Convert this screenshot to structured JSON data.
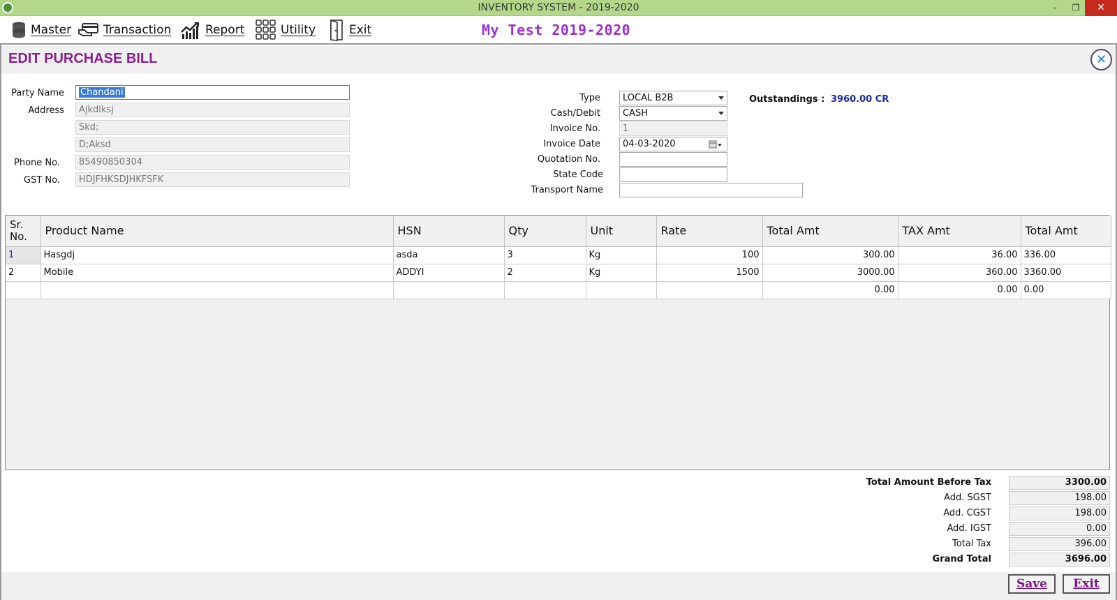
{
  "window": {
    "title": "INVENTORY SYSTEM - 2019-2020",
    "min": "–",
    "max": "❐",
    "close": "✕"
  },
  "menu": {
    "master": "Master",
    "transaction": "Transaction",
    "report": "Report",
    "utility": "Utility",
    "exit": "Exit"
  },
  "company": "My Test 2019-2020",
  "form": {
    "title": "EDIT PURCHASE BILL",
    "close": "✕"
  },
  "party": {
    "name_label": "Party Name",
    "name": "Chandani",
    "address_label": "Address",
    "address1": "Ajkdlksj",
    "address2": "Skd;",
    "address3": "D;Aksd",
    "phone_label": "Phone No.",
    "phone": "85490850304",
    "gst_label": "GST No.",
    "gst": "HDJFHKSDJHKFSFK"
  },
  "bill": {
    "type_label": "Type",
    "type": "LOCAL B2B",
    "cash_label": "Cash/Debit",
    "cash": "CASH",
    "invoice_no_label": "Invoice No.",
    "invoice_no": "1",
    "invoice_date_label": "Invoice Date",
    "invoice_date": "04-03-2020",
    "quotation_label": "Quotation No.",
    "quotation": "",
    "state_label": "State Code",
    "state": "",
    "transport_label": "Transport Name",
    "transport": ""
  },
  "outstanding": {
    "label": "Outstandings :",
    "value": "3960.00 CR"
  },
  "grid": {
    "headers": {
      "sr1": "Sr.",
      "sr2": "No.",
      "product": "Product Name",
      "hsn": "HSN",
      "qty": "Qty",
      "unit": "Unit",
      "rate": "Rate",
      "total": "Total Amt",
      "tax": "TAX Amt",
      "total2": "Total Amt"
    },
    "rows": [
      {
        "sr": "1",
        "product": "Hasgdj",
        "hsn": "asda",
        "qty": "3",
        "unit": "Kg",
        "rate": "100",
        "total": "300.00",
        "tax": "36.00",
        "total2": "336.00"
      },
      {
        "sr": "2",
        "product": "Mobile",
        "hsn": "ADDYI",
        "qty": "2",
        "unit": "Kg",
        "rate": "1500",
        "total": "3000.00",
        "tax": "360.00",
        "total2": "3360.00"
      },
      {
        "sr": "",
        "product": "",
        "hsn": "",
        "qty": "",
        "unit": "",
        "rate": "",
        "total": "0.00",
        "tax": "0.00",
        "total2": "0.00"
      }
    ]
  },
  "totals": {
    "before_tax_label": "Total Amount Before Tax",
    "before_tax": "3300.00",
    "sgst_label": "Add. SGST",
    "sgst": "198.00",
    "cgst_label": "Add. CGST",
    "cgst": "198.00",
    "igst_label": "Add. IGST",
    "igst": "0.00",
    "total_tax_label": "Total Tax",
    "total_tax": "396.00",
    "grand_label": "Grand Total",
    "grand": "3696.00"
  },
  "buttons": {
    "save_u": "S",
    "save_rest": "ave",
    "exit_first": "E",
    "exit_u": "x",
    "exit_rest": "it"
  }
}
